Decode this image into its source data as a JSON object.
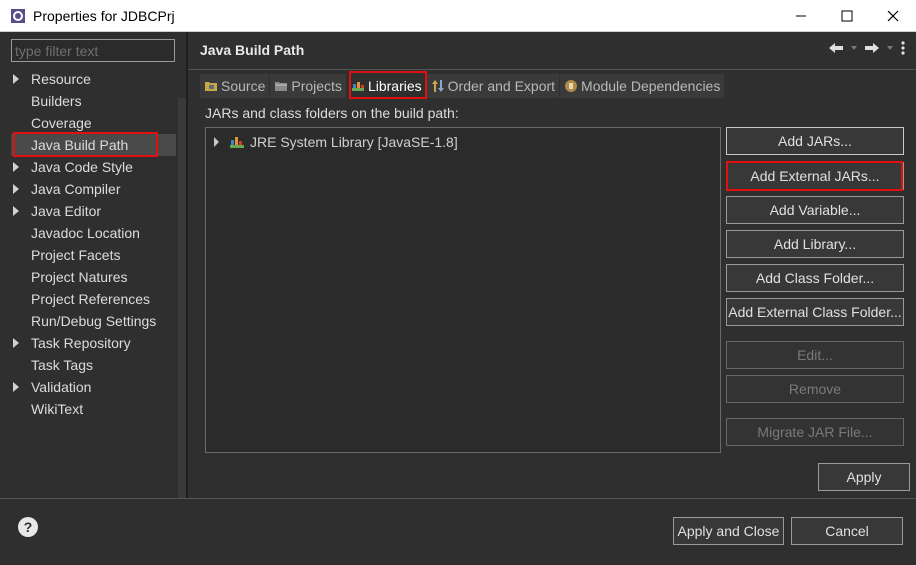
{
  "window": {
    "title": "Properties for JDBCPrj",
    "controls": [
      "minimize-icon",
      "maximize-icon",
      "close-icon"
    ]
  },
  "sidebar": {
    "filter_placeholder": "type filter text",
    "items": [
      {
        "label": "Resource",
        "expandable": true
      },
      {
        "label": "Builders",
        "expandable": false
      },
      {
        "label": "Coverage",
        "expandable": false
      },
      {
        "label": "Java Build Path",
        "expandable": false,
        "selected": true
      },
      {
        "label": "Java Code Style",
        "expandable": true
      },
      {
        "label": "Java Compiler",
        "expandable": true
      },
      {
        "label": "Java Editor",
        "expandable": true
      },
      {
        "label": "Javadoc Location",
        "expandable": false
      },
      {
        "label": "Project Facets",
        "expandable": false
      },
      {
        "label": "Project Natures",
        "expandable": false
      },
      {
        "label": "Project References",
        "expandable": false
      },
      {
        "label": "Run/Debug Settings",
        "expandable": false
      },
      {
        "label": "Task Repository",
        "expandable": true
      },
      {
        "label": "Task Tags",
        "expandable": false
      },
      {
        "label": "Validation",
        "expandable": true
      },
      {
        "label": "WikiText",
        "expandable": false
      }
    ]
  },
  "main": {
    "title": "Java Build Path",
    "tabs": [
      {
        "label": "Source",
        "icon": "source-folder-icon"
      },
      {
        "label": "Projects",
        "icon": "projects-icon"
      },
      {
        "label": "Libraries",
        "icon": "libraries-icon",
        "active": true
      },
      {
        "label": "Order and Export",
        "icon": "order-export-icon"
      },
      {
        "label": "Module Dependencies",
        "icon": "module-icon"
      }
    ],
    "list_label": "JARs and class folders on the build path:",
    "libraries": [
      {
        "label": "JRE System Library [JavaSE-1.8]"
      }
    ],
    "buttons": {
      "add_jars": "Add JARs...",
      "add_external_jars": "Add External JARs...",
      "add_variable": "Add Variable...",
      "add_library": "Add Library...",
      "add_class_folder": "Add Class Folder...",
      "add_external_class_folder": "Add External Class Folder...",
      "edit": "Edit...",
      "remove": "Remove",
      "migrate_jar": "Migrate JAR File..."
    },
    "apply": "Apply"
  },
  "footer": {
    "apply_and_close": "Apply and Close",
    "cancel": "Cancel"
  },
  "colors": {
    "background": "#2f2f2f",
    "highlight": "#e01010"
  }
}
